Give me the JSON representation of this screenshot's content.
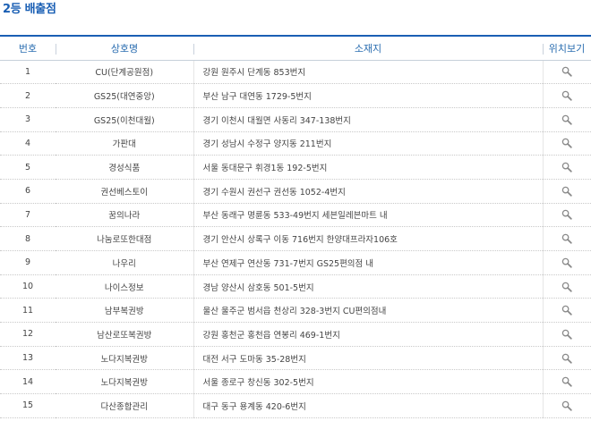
{
  "page": {
    "title": "2등 배출점"
  },
  "table": {
    "headers": {
      "num": "번호",
      "name": "상호명",
      "address": "소재지",
      "location": "위치보기"
    },
    "rows": [
      {
        "num": "1",
        "name": "CU(단계공원점)",
        "address": "강원 원주시 단계동 853번지"
      },
      {
        "num": "2",
        "name": "GS25(대연중앙)",
        "address": "부산 남구 대연동 1729-5번지"
      },
      {
        "num": "3",
        "name": "GS25(이천대월)",
        "address": "경기 이천시 대월면 사동리 347-138번지"
      },
      {
        "num": "4",
        "name": "가판대",
        "address": "경기 성남시 수정구 양지동 211번지"
      },
      {
        "num": "5",
        "name": "경성식품",
        "address": "서울 동대문구 휘경1동 192-5번지"
      },
      {
        "num": "6",
        "name": "권선베스토이",
        "address": "경기 수원시 권선구 권선동 1052-4번지"
      },
      {
        "num": "7",
        "name": "꿈의나라",
        "address": "부산 동래구 명륜동 533-49번지 세븐일레븐마트 내"
      },
      {
        "num": "8",
        "name": "나눔로또한대점",
        "address": "경기 안산시 상록구 이동 716번지 한양대프라자106호"
      },
      {
        "num": "9",
        "name": "나우리",
        "address": "부산 연제구 연산동 731-7번지 GS25편의점 내"
      },
      {
        "num": "10",
        "name": "나이스정보",
        "address": "경남 양산시 삼호동 501-5번지"
      },
      {
        "num": "11",
        "name": "남부복권방",
        "address": "울산 울주군 범서읍 천상리 328-3번지 CU편의점내"
      },
      {
        "num": "12",
        "name": "남산로또복권방",
        "address": "강원 홍천군 홍천읍 연봉리 469-1번지"
      },
      {
        "num": "13",
        "name": "노다지복권방",
        "address": "대전 서구 도마동 35-28번지"
      },
      {
        "num": "14",
        "name": "노다지복권방",
        "address": "서울 종로구 창신동 302-5번지"
      },
      {
        "num": "15",
        "name": "다산종합관리",
        "address": "대구 동구 용계동 420-6번지"
      }
    ]
  },
  "icons": {
    "location": "search-icon"
  },
  "colors": {
    "title": "#1a5fb4",
    "header_text": "#2a6db0",
    "header_border": "#1a5fb4",
    "body_text": "#444444"
  }
}
